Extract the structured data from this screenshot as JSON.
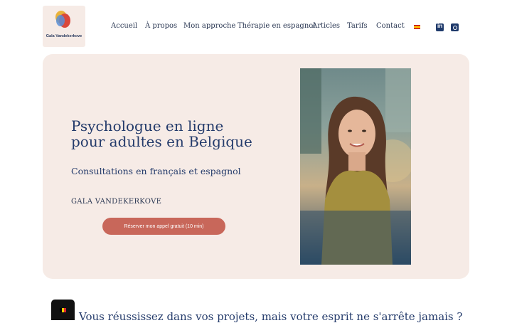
{
  "logo": {
    "text": "Gala Vandekerkove"
  },
  "nav": {
    "items": [
      "Accueil",
      "À propos",
      "Mon approche",
      "Thérapie en espagnol",
      "Articles",
      "Tarifs",
      "Contact"
    ],
    "language_flag": "spanish-flag-icon",
    "social": [
      "linkedin-icon",
      "instagram-icon"
    ]
  },
  "hero": {
    "title_line1": "Psychologue en ligne",
    "title_line2": "pour adultes en Belgique",
    "subtitle": "Consultations en français et espagnol",
    "name": "GALA VANDEKERKOVE",
    "cta_label": "Réserver mon appel gratuit (10 min)"
  },
  "section": {
    "question": "Vous réussissez dans vos projets, mais votre esprit ne s'arrête jamais ?",
    "language_badge": "belgian-flag-icon"
  },
  "colors": {
    "hero_bg": "#f6ebe6",
    "title": "#243b6b",
    "cta": "#c8675a"
  }
}
